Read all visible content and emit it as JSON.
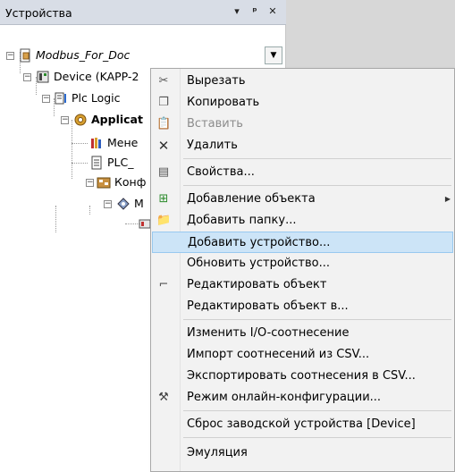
{
  "pane": {
    "title": "Устройства",
    "dropdown_glyph": "▾",
    "pin_glyph": "ᵖ",
    "close_glyph": "✕"
  },
  "tree": {
    "root": "Modbus_For_Doc",
    "device": "Device (KAPP-2",
    "plc_logic": "Plc Logic",
    "application": "Applicat",
    "manager": "Мене",
    "plc_prg": "PLC_",
    "config": "Конф",
    "modbus": "M"
  },
  "menu": {
    "items": [
      {
        "label": "Вырезать",
        "icon": "scissors-icon",
        "glyph": "✂",
        "enabled": true
      },
      {
        "label": "Копировать",
        "icon": "copy-icon",
        "glyph": "❐",
        "enabled": true
      },
      {
        "label": "Вставить",
        "icon": "paste-icon",
        "glyph": "📋",
        "enabled": false
      },
      {
        "label": "Удалить",
        "icon": "delete-icon",
        "glyph": "✕",
        "enabled": true
      },
      {
        "label": "Свойства...",
        "icon": "properties-icon",
        "glyph": "▤",
        "enabled": true
      },
      {
        "label": "Добавление объекта",
        "icon": "add-object-icon",
        "glyph": "⊞",
        "enabled": true,
        "submenu": true
      },
      {
        "label": "Добавить папку...",
        "icon": "folder-icon",
        "glyph": "📁",
        "enabled": true
      },
      {
        "label": "Добавить устройство...",
        "icon": "",
        "glyph": "",
        "enabled": true,
        "highlighted": true
      },
      {
        "label": "Обновить устройство...",
        "icon": "",
        "glyph": "",
        "enabled": true
      },
      {
        "label": "Редактировать объект",
        "icon": "edit-object-icon",
        "glyph": "⌐",
        "enabled": true
      },
      {
        "label": "Редактировать объект в...",
        "icon": "",
        "glyph": "",
        "enabled": true
      },
      {
        "label": "Изменить I/O-соотнесение",
        "icon": "",
        "glyph": "",
        "enabled": true
      },
      {
        "label": "Импорт соотнесений из CSV...",
        "icon": "",
        "glyph": "",
        "enabled": true
      },
      {
        "label": "Экспортировать соотнесения в CSV...",
        "icon": "",
        "glyph": "",
        "enabled": true
      },
      {
        "label": "Режим онлайн-конфигурации...",
        "icon": "online-config-icon",
        "glyph": "⚒",
        "enabled": true
      },
      {
        "label": "Сброс заводской устройства [Device]",
        "icon": "",
        "glyph": "",
        "enabled": true
      },
      {
        "label": "Эмуляция",
        "icon": "",
        "glyph": "",
        "enabled": true
      }
    ],
    "submenu_arrow": "▶"
  }
}
